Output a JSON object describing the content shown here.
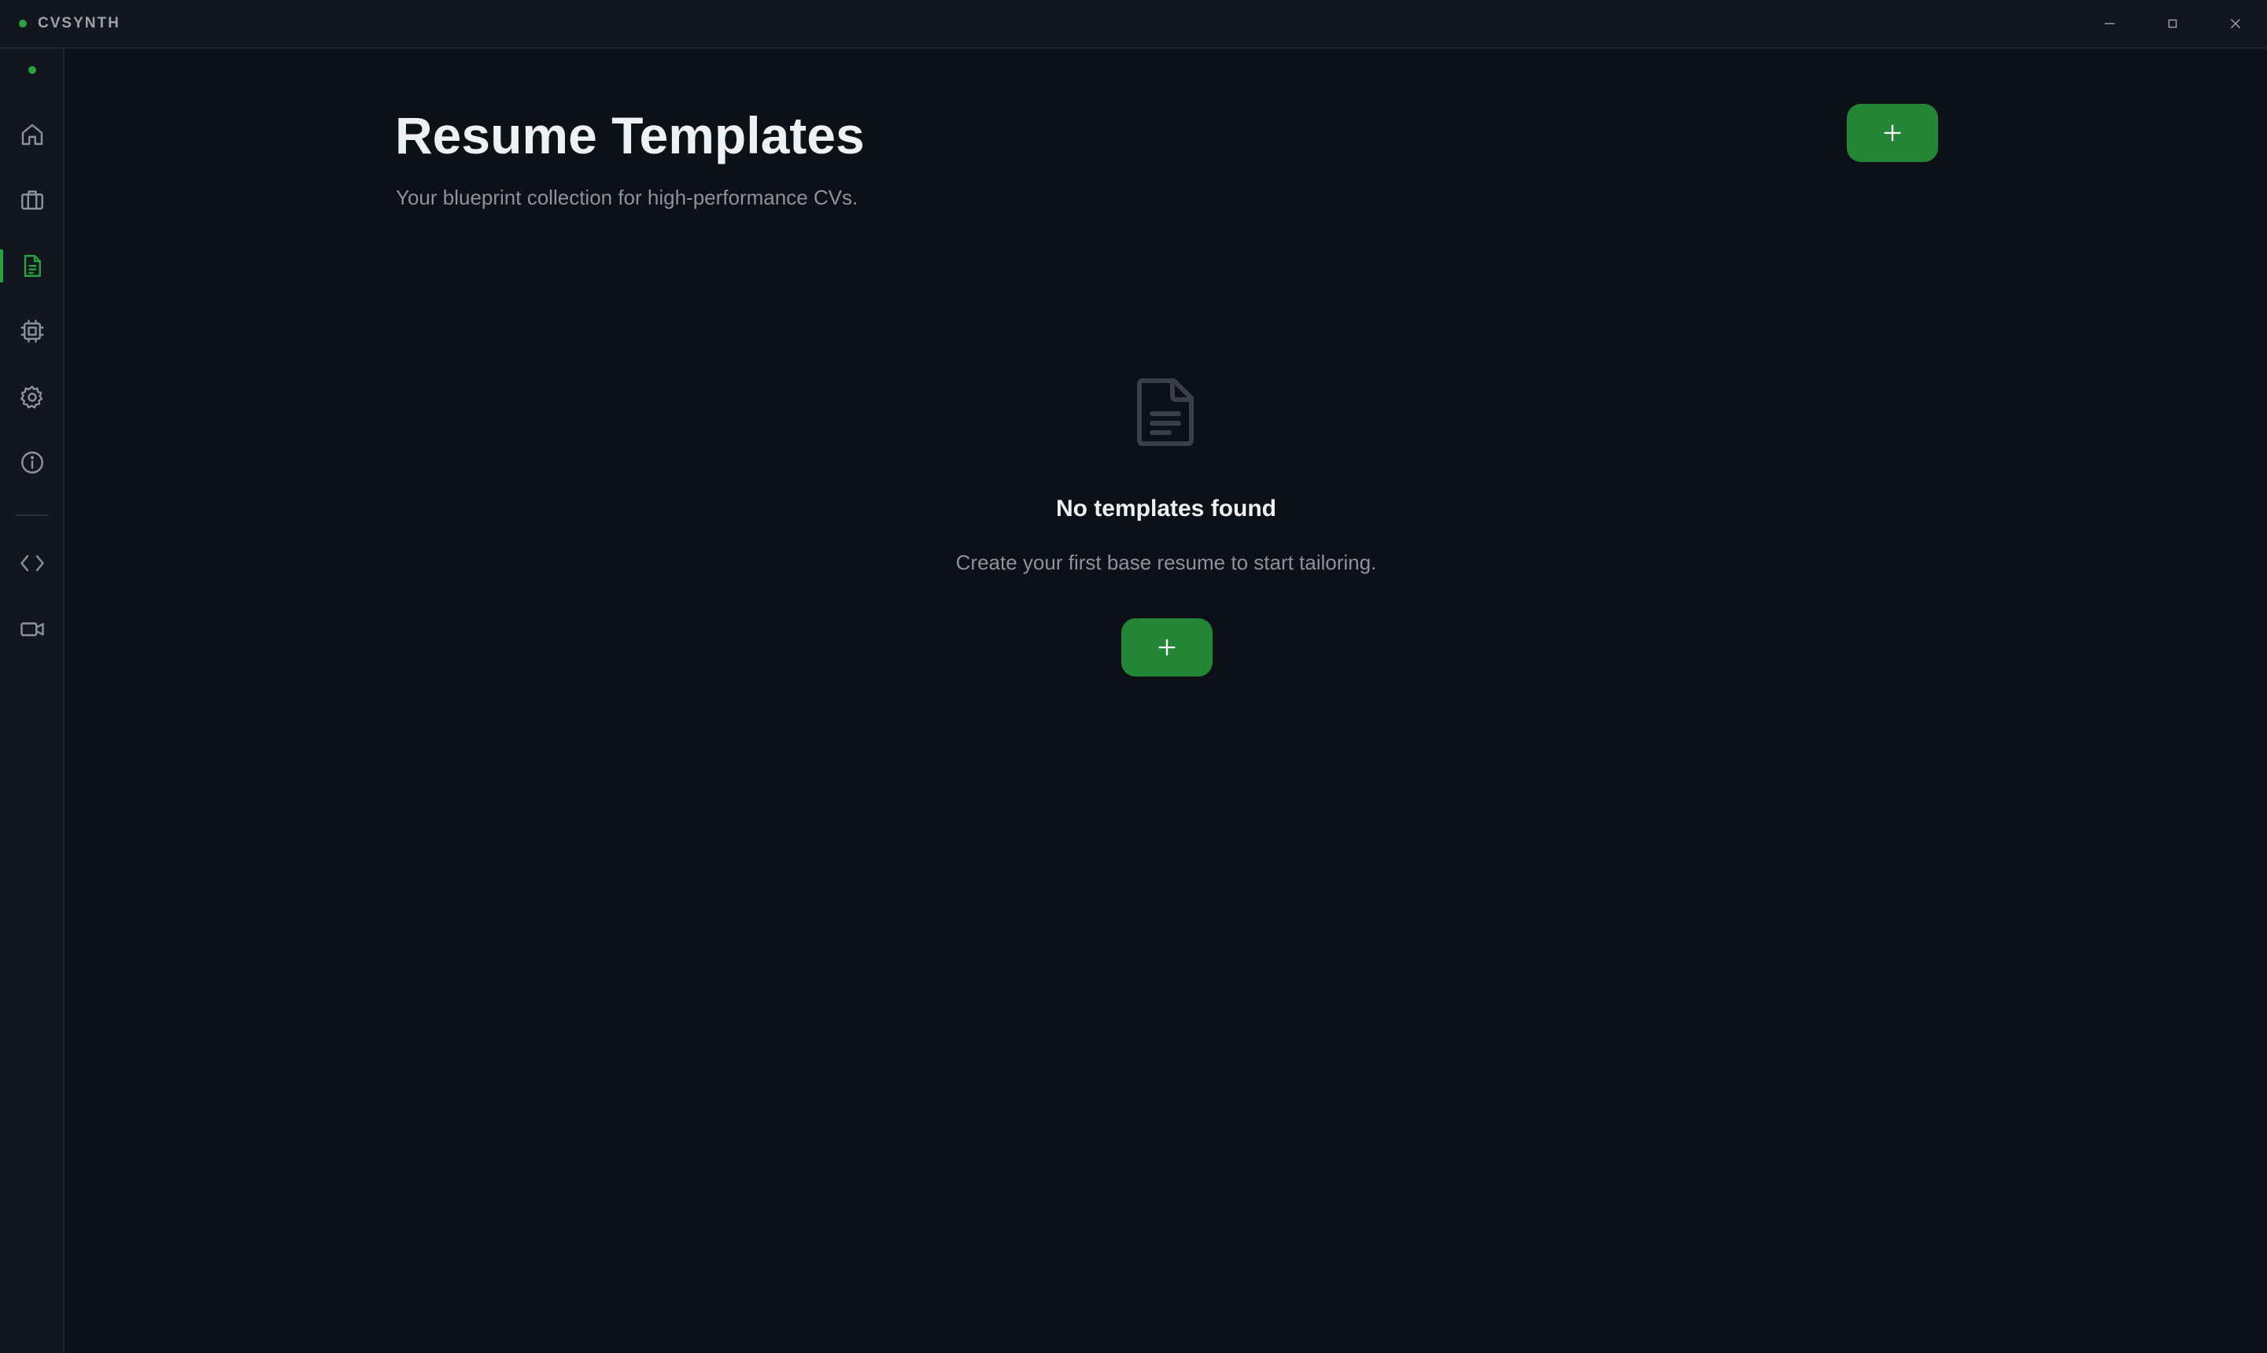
{
  "app": {
    "name": "CVSYNTH",
    "accent_color": "#2ea043"
  },
  "window_controls": [
    {
      "name": "minimize-icon"
    },
    {
      "name": "maximize-icon"
    },
    {
      "name": "close-icon"
    }
  ],
  "sidebar": {
    "items": [
      {
        "id": "home",
        "icon": "home-icon",
        "active": false
      },
      {
        "id": "jobs",
        "icon": "briefcase-icon",
        "active": false
      },
      {
        "id": "templates",
        "icon": "document-icon",
        "active": true
      },
      {
        "id": "ai",
        "icon": "cpu-chip-icon",
        "active": false
      },
      {
        "id": "settings",
        "icon": "gear-icon",
        "active": false
      },
      {
        "id": "about",
        "icon": "info-icon",
        "active": false
      },
      {
        "id": "developer",
        "icon": "code-icon",
        "active": false
      },
      {
        "id": "recording",
        "icon": "video-icon",
        "active": false
      }
    ]
  },
  "main": {
    "title": "Resume Templates",
    "subtitle": "Your blueprint collection for high-performance CVs.",
    "add_button_icon": "plus-icon"
  },
  "empty_state": {
    "icon": "file-text-icon",
    "title": "No templates found",
    "text": "Create your first base resume to start tailoring."
  }
}
